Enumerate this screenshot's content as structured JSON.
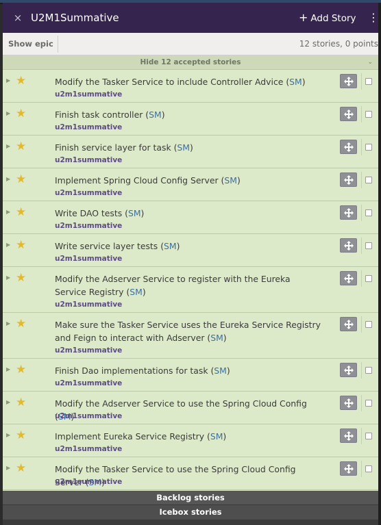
{
  "header": {
    "close_glyph": "×",
    "title": "U2M1Summative",
    "add_story_label": "Add Story",
    "add_story_plus": "+",
    "menu_glyph": "⋮"
  },
  "subbar": {
    "show_epic_label": "Show epic",
    "points_summary": "12 stories, 0 points"
  },
  "accepted": {
    "toggle_label": "Hide 12 accepted stories",
    "chevron": "⌄"
  },
  "stories": [
    {
      "name": "Modify the Tasker Service to include Controller Advice",
      "owner": "SM",
      "label": "u2m1summative"
    },
    {
      "name": "Finish task controller",
      "owner": "SM",
      "label": "u2m1summative"
    },
    {
      "name": "Finish service layer for task",
      "owner": "SM",
      "label": "u2m1summative"
    },
    {
      "name": "Implement Spring Cloud Config Server",
      "owner": "SM",
      "label": "u2m1summative"
    },
    {
      "name": "Write DAO tests",
      "owner": "SM",
      "label": "u2m1summative"
    },
    {
      "name": "Write service layer tests",
      "owner": "SM",
      "label": "u2m1summative"
    },
    {
      "name": "Modify the Adserver Service to register with the Eureka Service Registry",
      "owner": "SM",
      "label": "u2m1summative"
    },
    {
      "name": "Make sure the Tasker Service uses the Eureka Service Registry and Feign to interact with Adserver",
      "owner": "SM",
      "label": "u2m1summative"
    },
    {
      "name": "Finish Dao implementations for task",
      "owner": "SM",
      "label": "u2m1summative"
    },
    {
      "name": "Modify the Adserver Service to use the Spring Cloud Config",
      "owner": "SM",
      "label": "u2m1summative"
    },
    {
      "name": "Implement Eureka Service Registry ",
      "owner": "SM",
      "label": "u2m1summative"
    },
    {
      "name": "Modify the Tasker Service to use the Spring Cloud Config Server",
      "owner": "SM",
      "label": "u2m1summative"
    }
  ],
  "sections": {
    "backlog_label": "Backlog stories",
    "icebox_label": "Icebox stories"
  },
  "colors": {
    "header_bg": "#35254e",
    "accepted_bg": "#ddeac9",
    "star": "#e3b92e",
    "owner_link": "#3a6fa5",
    "label_text": "#5b4a86"
  }
}
